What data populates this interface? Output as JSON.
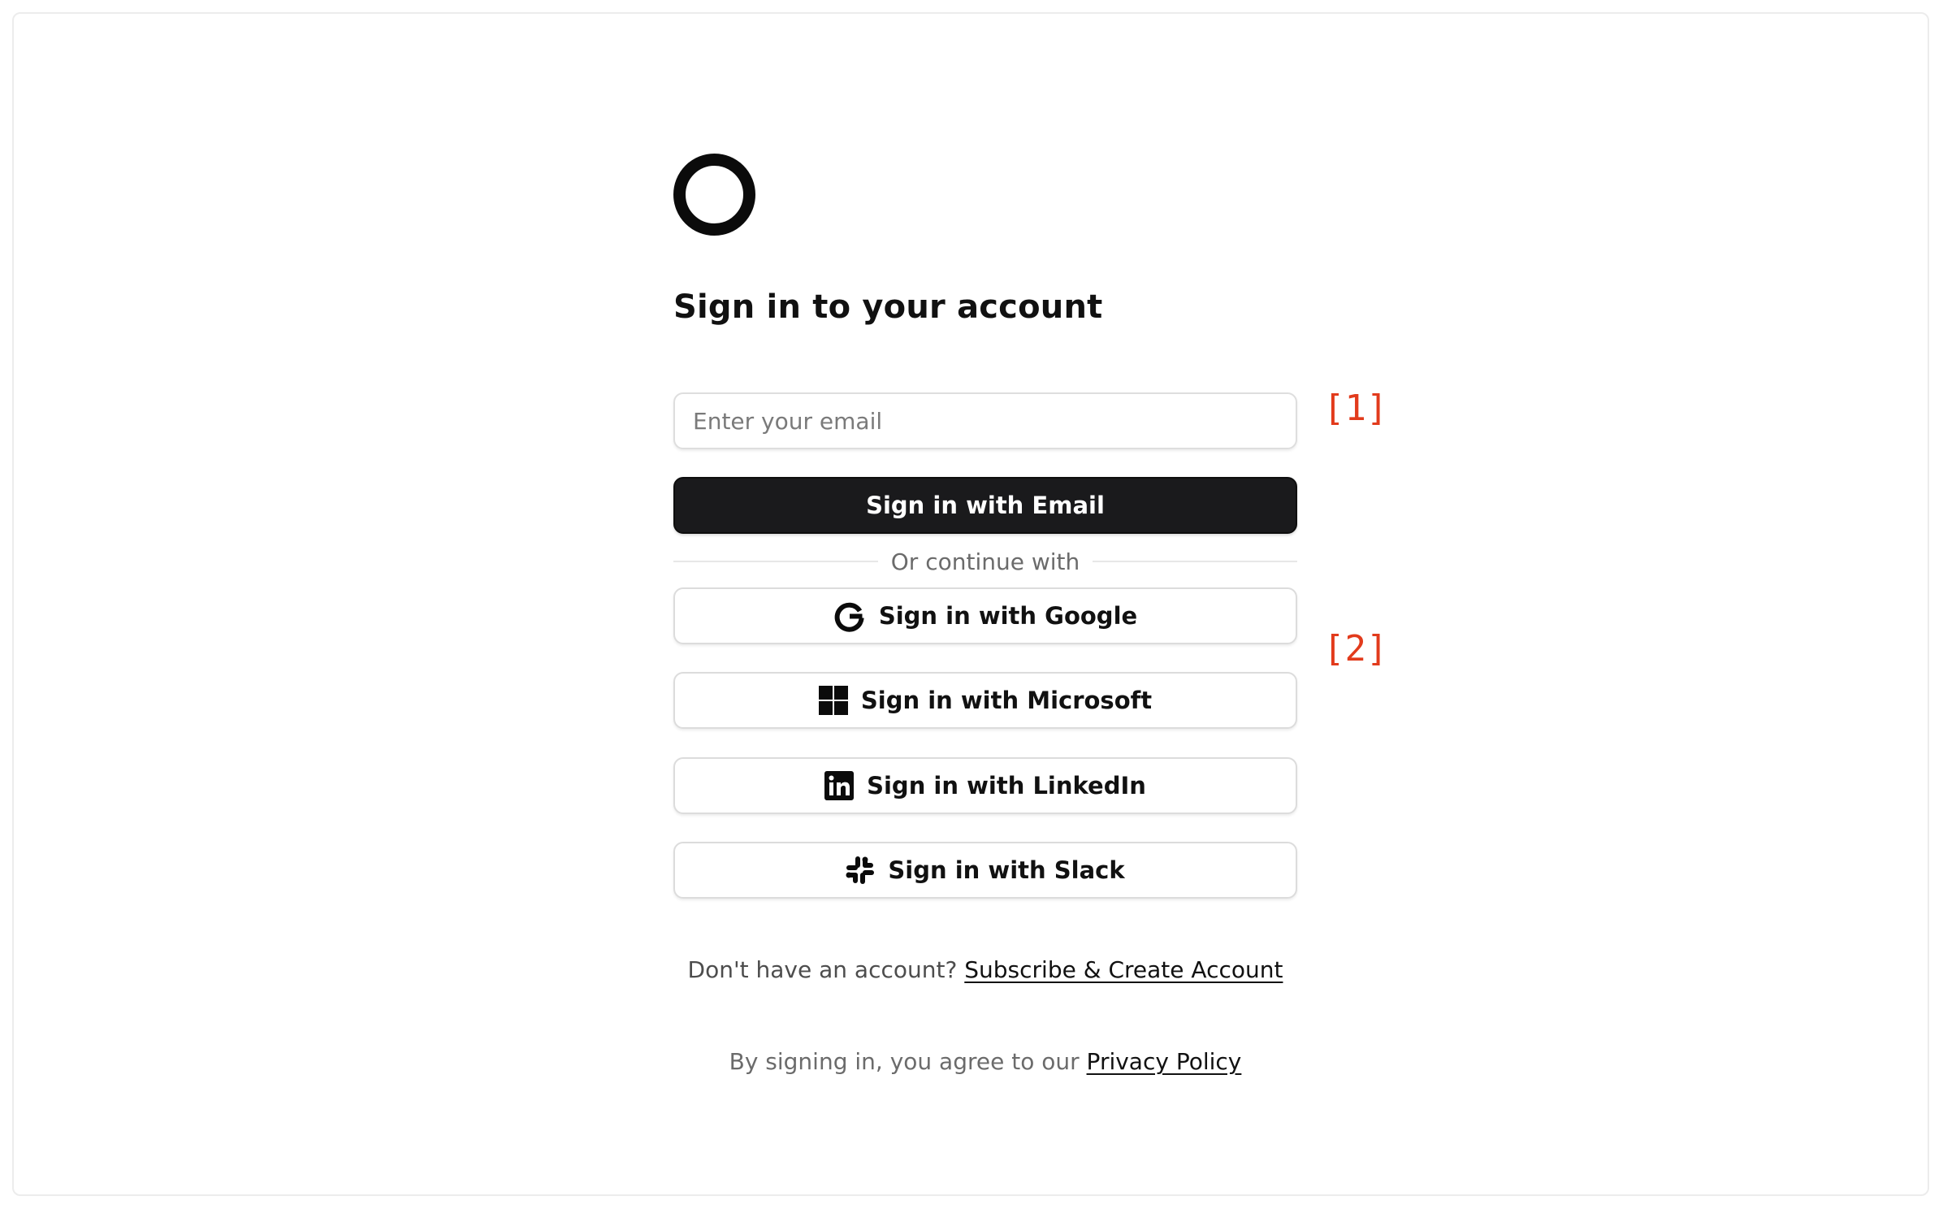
{
  "title": "Sign in to your account",
  "email": {
    "placeholder": "Enter your email",
    "value": ""
  },
  "buttons": {
    "email": "Sign in with Email",
    "google": "Sign in with Google",
    "microsoft": "Sign in with Microsoft",
    "linkedin": "Sign in with LinkedIn",
    "slack": "Sign in with Slack"
  },
  "divider_text": "Or continue with",
  "markers": {
    "one": "[1]",
    "two": "[2]"
  },
  "signup": {
    "prompt": "Don't have an account?",
    "link": "Subscribe & Create Account"
  },
  "privacy": {
    "prompt": "By signing in, you agree to our",
    "link": "Privacy Policy"
  },
  "icons": {
    "logo": "ring-logo-icon",
    "google": "google-icon",
    "microsoft": "microsoft-icon",
    "linkedin": "linkedin-icon",
    "slack": "slack-icon"
  },
  "colors": {
    "primary_button": "#1a1a1c",
    "marker": "#e23b1c",
    "border": "#dedede"
  }
}
